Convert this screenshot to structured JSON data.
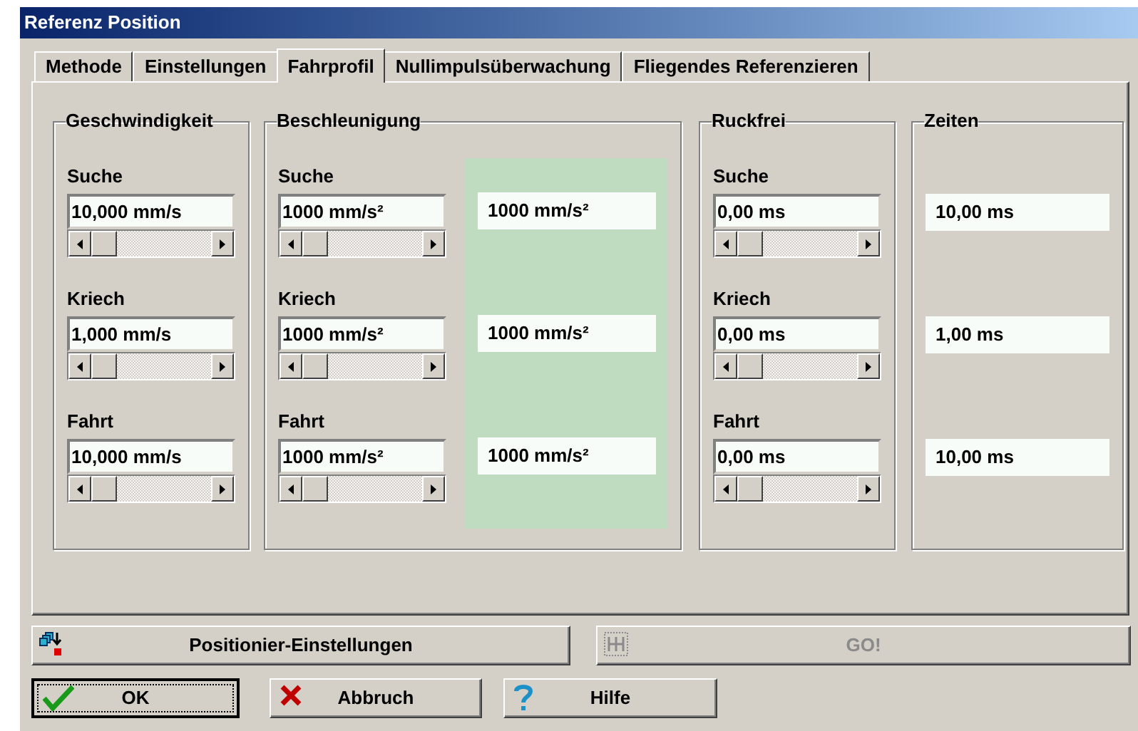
{
  "window": {
    "title": "Referenz Position"
  },
  "tabs": [
    {
      "label": "Methode",
      "selected": false
    },
    {
      "label": "Einstellungen",
      "selected": false
    },
    {
      "label": "Fahrprofil",
      "selected": true
    },
    {
      "label": "Nullimpulsüberwachung",
      "selected": false
    },
    {
      "label": "Fliegendes Referenzieren",
      "selected": false
    }
  ],
  "groups": [
    {
      "title": "Geschwindigkeit",
      "kind": "inputs",
      "rows": [
        {
          "label": "Suche",
          "value": "10,000 mm/s"
        },
        {
          "label": "Kriech",
          "value": "1,000 mm/s"
        },
        {
          "label": "Fahrt",
          "value": "10,000 mm/s"
        }
      ]
    },
    {
      "title": "Beschleunigung",
      "kind": "inputs_readout",
      "rows": [
        {
          "label": "Suche",
          "value": "1000 mm/s²",
          "readout": "1000 mm/s²"
        },
        {
          "label": "Kriech",
          "value": "1000 mm/s²",
          "readout": "1000 mm/s²"
        },
        {
          "label": "Fahrt",
          "value": "1000 mm/s²",
          "readout": "1000 mm/s²"
        }
      ]
    },
    {
      "title": "Ruckfrei",
      "kind": "inputs",
      "rows": [
        {
          "label": "Suche",
          "value": "0,00 ms"
        },
        {
          "label": "Kriech",
          "value": "0,00 ms"
        },
        {
          "label": "Fahrt",
          "value": "0,00 ms"
        }
      ]
    },
    {
      "title": "Zeiten",
      "kind": "readouts",
      "rows": [
        {
          "readout": "10,00 ms"
        },
        {
          "readout": "1,00 ms"
        },
        {
          "readout": "10,00 ms"
        }
      ]
    }
  ],
  "action_buttons": [
    {
      "label": "Positionier-Einstellungen",
      "disabled": false
    },
    {
      "label": "GO!",
      "disabled": true
    }
  ],
  "dialog_buttons": [
    {
      "label": "OK",
      "focused": true
    },
    {
      "label": "Abbruch",
      "focused": false
    },
    {
      "label": "Hilfe",
      "focused": false
    }
  ]
}
